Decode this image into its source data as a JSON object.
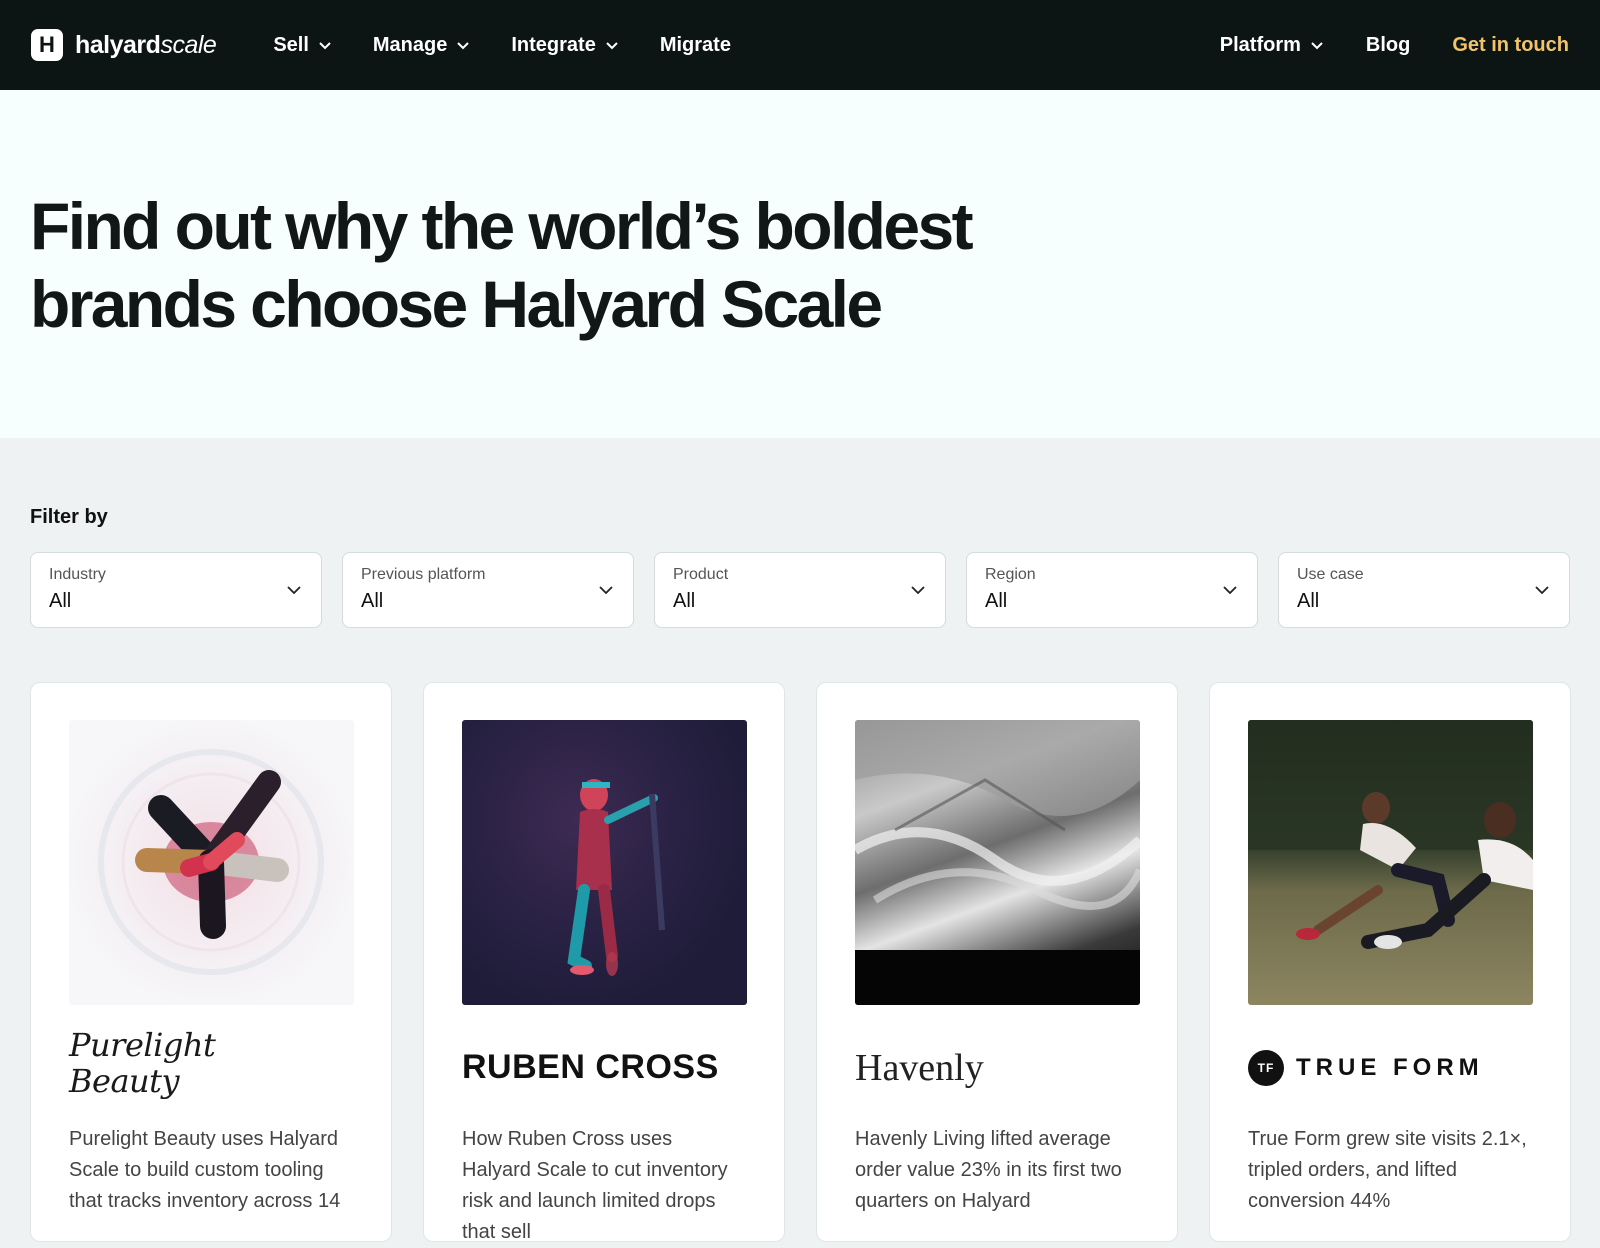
{
  "logo": {
    "mark": "H",
    "word_bold": "halyard",
    "word_light": "scale"
  },
  "nav": {
    "left": [
      {
        "label": "Sell",
        "dropdown": true
      },
      {
        "label": "Manage",
        "dropdown": true
      },
      {
        "label": "Integrate",
        "dropdown": true
      },
      {
        "label": "Migrate",
        "dropdown": false
      }
    ],
    "right": [
      {
        "label": "Platform",
        "dropdown": true
      },
      {
        "label": "Blog",
        "dropdown": false
      }
    ],
    "cta_label": "Get in touch",
    "cta_color": "#f2c46a"
  },
  "hero": {
    "title_line1": "Find out why the world’s boldest",
    "title_line2": "brands choose Halyard Scale"
  },
  "filters": {
    "heading": "Filter by",
    "items": [
      {
        "label": "Industry",
        "value": "All"
      },
      {
        "label": "Previous platform",
        "value": "All"
      },
      {
        "label": "Product",
        "value": "All"
      },
      {
        "label": "Region",
        "value": "All"
      },
      {
        "label": "Use case",
        "value": "All"
      }
    ]
  },
  "cards": [
    {
      "brand_line1": "Purelight",
      "brand_line2": "Beauty",
      "description": "Purelight Beauty uses Halyard Scale to build custom tooling that tracks inventory across 14",
      "image": "lipsticks-in-glass"
    },
    {
      "brand": "RUBEN CROSS",
      "description": "How Ruben Cross uses Halyard Scale to cut inventory risk and launch limited drops that sell",
      "image": "athlete-neon-light"
    },
    {
      "brand": "Havenly",
      "description": "Havenly Living lifted average order value 23% in its first two quarters on Halyard",
      "image": "bedding-monochrome"
    },
    {
      "brand_mark": "TF",
      "brand": "TRUE FORM",
      "description": "True Form grew site visits 2.1×, tripled orders, and lifted conversion 44%",
      "image": "women-stretching-outdoors"
    }
  ],
  "colors": {
    "nav_bg": "#0d1414",
    "hero_bg": "#f7fefe",
    "page_bg": "#eef2f2"
  }
}
